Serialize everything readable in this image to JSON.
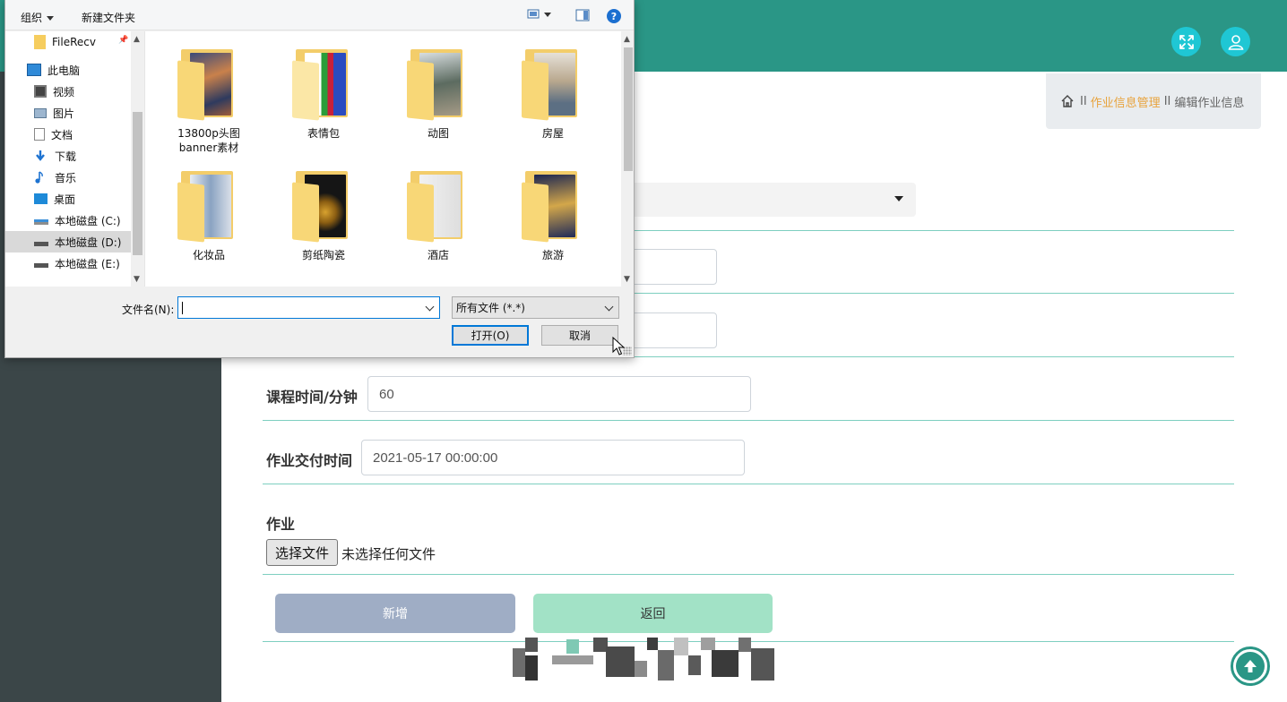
{
  "header": {
    "fullscreen_icon": "fullscreen-icon",
    "user_icon": "user-icon",
    "accent_color": "#2a9686"
  },
  "breadcrumb": {
    "home_icon": "home-icon",
    "sep": "II",
    "section": "作业信息管理",
    "current": "编辑作业信息"
  },
  "form": {
    "course_time": {
      "label": "课程时间/分钟",
      "value": "60"
    },
    "deliver_time": {
      "label": "作业交付时间",
      "value": "2021-05-17 00:00:00"
    },
    "homework": {
      "label": "作业",
      "file_button": "选择文件",
      "file_status": "未选择任何文件"
    },
    "add_button": "新增",
    "back_button": "返回"
  },
  "dialog": {
    "toolbar": {
      "organize": "组织",
      "new_folder": "新建文件夹",
      "help": "?"
    },
    "nav_items": [
      {
        "label": "FileRecv",
        "icon": "folder-icon"
      },
      {
        "label": "此电脑",
        "icon": "computer-icon"
      },
      {
        "label": "视频",
        "icon": "video-icon"
      },
      {
        "label": "图片",
        "icon": "picture-icon"
      },
      {
        "label": "文档",
        "icon": "document-icon"
      },
      {
        "label": "下载",
        "icon": "download-icon"
      },
      {
        "label": "音乐",
        "icon": "music-icon"
      },
      {
        "label": "桌面",
        "icon": "desktop-icon"
      },
      {
        "label": "本地磁盘 (C:)",
        "icon": "drive-icon"
      },
      {
        "label": "本地磁盘 (D:)",
        "icon": "drive-icon",
        "selected": true
      },
      {
        "label": "本地磁盘 (E:)",
        "icon": "drive-icon"
      }
    ],
    "folders": [
      {
        "name": "13800p头图\nbanner素材"
      },
      {
        "name": "表情包"
      },
      {
        "name": "动图"
      },
      {
        "name": "房屋"
      },
      {
        "name": "化妆品"
      },
      {
        "name": "剪纸陶瓷"
      },
      {
        "name": "酒店"
      },
      {
        "name": "旅游"
      }
    ],
    "filename_label": "文件名(N):",
    "filename_value": "",
    "filetype": "所有文件 (*.*)",
    "open_button": "打开(O)",
    "cancel_button": "取消"
  }
}
